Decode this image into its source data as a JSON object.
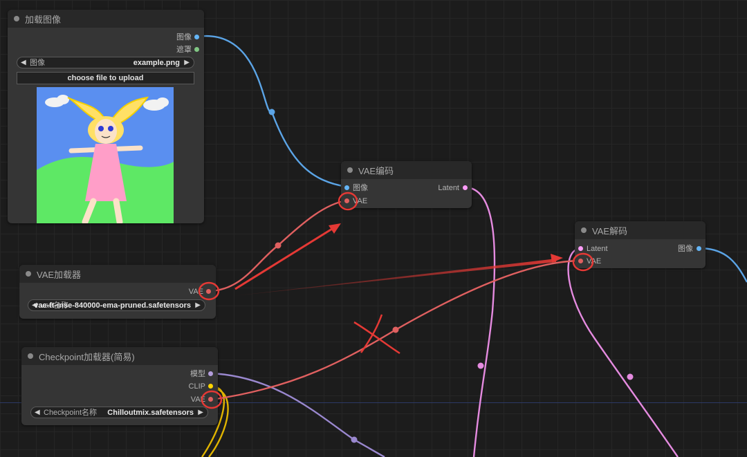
{
  "nodes": {
    "load_image": {
      "title": "加载图像",
      "outputs": [
        "图像",
        "遮罩"
      ],
      "image_widget": {
        "label": "图像",
        "value": "example.png"
      },
      "upload_label": "choose file to upload"
    },
    "vae_encode": {
      "title": "VAE编码",
      "inputs": [
        "图像",
        "VAE"
      ],
      "outputs": [
        "Latent"
      ]
    },
    "vae_decode": {
      "title": "VAE解码",
      "inputs": [
        "Latent",
        "VAE"
      ],
      "outputs": [
        "图像"
      ]
    },
    "vae_loader": {
      "title": "VAE加载器",
      "outputs": [
        "VAE"
      ],
      "widget": {
        "label": "vae名称",
        "value": "vae-ft-mse-840000-ema-pruned.safetensors"
      }
    },
    "checkpoint_loader": {
      "title": "Checkpoint加载器(简易)",
      "outputs": [
        "模型",
        "CLIP",
        "VAE"
      ],
      "widget": {
        "label": "Checkpoint名称",
        "value": "Chilloutmix.safetensors"
      }
    }
  },
  "colors": {
    "image": "#64b5f6",
    "mask": "#81c784",
    "latent": "#ff9cf9",
    "vae": "#ff6e6e",
    "model": "#b39ddb",
    "clip": "#ffd500",
    "annotation": "#e53935"
  }
}
